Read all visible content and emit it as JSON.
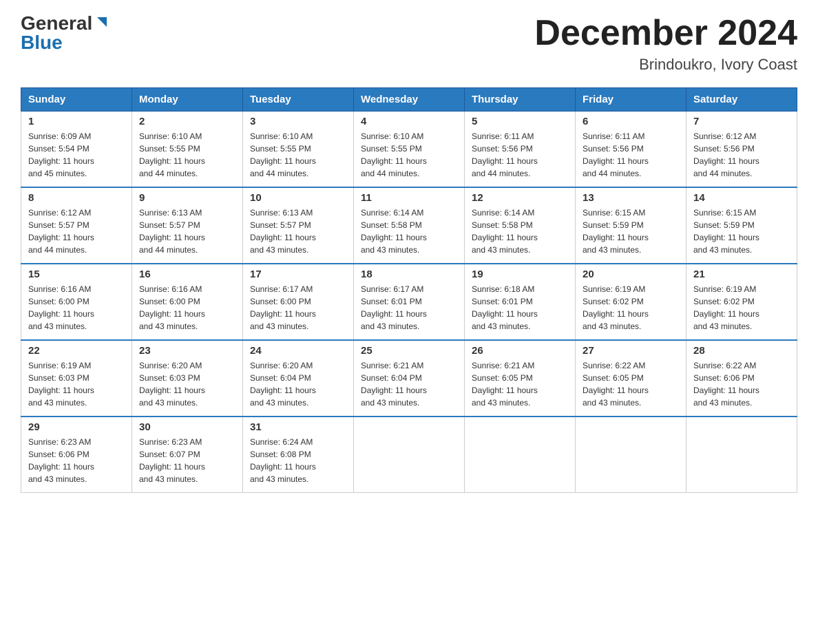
{
  "logo": {
    "general": "General",
    "blue": "Blue"
  },
  "title": "December 2024",
  "location": "Brindoukro, Ivory Coast",
  "days_of_week": [
    "Sunday",
    "Monday",
    "Tuesday",
    "Wednesday",
    "Thursday",
    "Friday",
    "Saturday"
  ],
  "weeks": [
    [
      {
        "num": "1",
        "info": "Sunrise: 6:09 AM\nSunset: 5:54 PM\nDaylight: 11 hours\nand 45 minutes."
      },
      {
        "num": "2",
        "info": "Sunrise: 6:10 AM\nSunset: 5:55 PM\nDaylight: 11 hours\nand 44 minutes."
      },
      {
        "num": "3",
        "info": "Sunrise: 6:10 AM\nSunset: 5:55 PM\nDaylight: 11 hours\nand 44 minutes."
      },
      {
        "num": "4",
        "info": "Sunrise: 6:10 AM\nSunset: 5:55 PM\nDaylight: 11 hours\nand 44 minutes."
      },
      {
        "num": "5",
        "info": "Sunrise: 6:11 AM\nSunset: 5:56 PM\nDaylight: 11 hours\nand 44 minutes."
      },
      {
        "num": "6",
        "info": "Sunrise: 6:11 AM\nSunset: 5:56 PM\nDaylight: 11 hours\nand 44 minutes."
      },
      {
        "num": "7",
        "info": "Sunrise: 6:12 AM\nSunset: 5:56 PM\nDaylight: 11 hours\nand 44 minutes."
      }
    ],
    [
      {
        "num": "8",
        "info": "Sunrise: 6:12 AM\nSunset: 5:57 PM\nDaylight: 11 hours\nand 44 minutes."
      },
      {
        "num": "9",
        "info": "Sunrise: 6:13 AM\nSunset: 5:57 PM\nDaylight: 11 hours\nand 44 minutes."
      },
      {
        "num": "10",
        "info": "Sunrise: 6:13 AM\nSunset: 5:57 PM\nDaylight: 11 hours\nand 43 minutes."
      },
      {
        "num": "11",
        "info": "Sunrise: 6:14 AM\nSunset: 5:58 PM\nDaylight: 11 hours\nand 43 minutes."
      },
      {
        "num": "12",
        "info": "Sunrise: 6:14 AM\nSunset: 5:58 PM\nDaylight: 11 hours\nand 43 minutes."
      },
      {
        "num": "13",
        "info": "Sunrise: 6:15 AM\nSunset: 5:59 PM\nDaylight: 11 hours\nand 43 minutes."
      },
      {
        "num": "14",
        "info": "Sunrise: 6:15 AM\nSunset: 5:59 PM\nDaylight: 11 hours\nand 43 minutes."
      }
    ],
    [
      {
        "num": "15",
        "info": "Sunrise: 6:16 AM\nSunset: 6:00 PM\nDaylight: 11 hours\nand 43 minutes."
      },
      {
        "num": "16",
        "info": "Sunrise: 6:16 AM\nSunset: 6:00 PM\nDaylight: 11 hours\nand 43 minutes."
      },
      {
        "num": "17",
        "info": "Sunrise: 6:17 AM\nSunset: 6:00 PM\nDaylight: 11 hours\nand 43 minutes."
      },
      {
        "num": "18",
        "info": "Sunrise: 6:17 AM\nSunset: 6:01 PM\nDaylight: 11 hours\nand 43 minutes."
      },
      {
        "num": "19",
        "info": "Sunrise: 6:18 AM\nSunset: 6:01 PM\nDaylight: 11 hours\nand 43 minutes."
      },
      {
        "num": "20",
        "info": "Sunrise: 6:19 AM\nSunset: 6:02 PM\nDaylight: 11 hours\nand 43 minutes."
      },
      {
        "num": "21",
        "info": "Sunrise: 6:19 AM\nSunset: 6:02 PM\nDaylight: 11 hours\nand 43 minutes."
      }
    ],
    [
      {
        "num": "22",
        "info": "Sunrise: 6:19 AM\nSunset: 6:03 PM\nDaylight: 11 hours\nand 43 minutes."
      },
      {
        "num": "23",
        "info": "Sunrise: 6:20 AM\nSunset: 6:03 PM\nDaylight: 11 hours\nand 43 minutes."
      },
      {
        "num": "24",
        "info": "Sunrise: 6:20 AM\nSunset: 6:04 PM\nDaylight: 11 hours\nand 43 minutes."
      },
      {
        "num": "25",
        "info": "Sunrise: 6:21 AM\nSunset: 6:04 PM\nDaylight: 11 hours\nand 43 minutes."
      },
      {
        "num": "26",
        "info": "Sunrise: 6:21 AM\nSunset: 6:05 PM\nDaylight: 11 hours\nand 43 minutes."
      },
      {
        "num": "27",
        "info": "Sunrise: 6:22 AM\nSunset: 6:05 PM\nDaylight: 11 hours\nand 43 minutes."
      },
      {
        "num": "28",
        "info": "Sunrise: 6:22 AM\nSunset: 6:06 PM\nDaylight: 11 hours\nand 43 minutes."
      }
    ],
    [
      {
        "num": "29",
        "info": "Sunrise: 6:23 AM\nSunset: 6:06 PM\nDaylight: 11 hours\nand 43 minutes."
      },
      {
        "num": "30",
        "info": "Sunrise: 6:23 AM\nSunset: 6:07 PM\nDaylight: 11 hours\nand 43 minutes."
      },
      {
        "num": "31",
        "info": "Sunrise: 6:24 AM\nSunset: 6:08 PM\nDaylight: 11 hours\nand 43 minutes."
      },
      null,
      null,
      null,
      null
    ]
  ]
}
